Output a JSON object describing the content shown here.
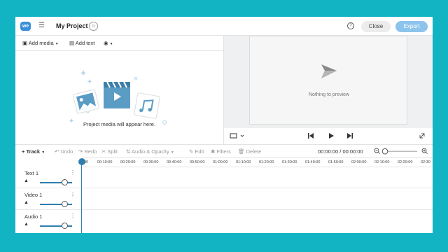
{
  "topbar": {
    "logo": "we",
    "project_title": "My Project",
    "close_label": "Close",
    "export_label": "Export"
  },
  "media_toolbar": {
    "add_media_label": "Add media",
    "add_text_label": "Add text"
  },
  "media_panel": {
    "empty_text": "Project media will appear here."
  },
  "preview": {
    "empty_text": "Nothing to preview"
  },
  "timeline_toolbar": {
    "track_label": "Track",
    "undo_label": "Undo",
    "redo_label": "Redo",
    "split_label": "Split",
    "audio_opacity_label": "Audio & Opacity",
    "edit_label": "Edit",
    "filters_label": "Filters",
    "delete_label": "Delete",
    "timecode": "00:00:00 / 00:00:00"
  },
  "ruler": {
    "ticks": [
      "00",
      "00:10:00",
      "00:20:00",
      "00:30:00",
      "00:40:00",
      "00:50:00",
      "01:00:00",
      "01:10:00",
      "01:20:00",
      "01:30:00",
      "01:40:00",
      "01:50:00",
      "02:00:00",
      "02:10:00",
      "02:20:00",
      "02:30"
    ]
  },
  "tracks": [
    {
      "name": "Text 1"
    },
    {
      "name": "Video 1"
    },
    {
      "name": "Audio 1"
    }
  ],
  "colors": {
    "background": "#12b4c4",
    "accent": "#2e7fb0",
    "export_button": "#8cc4ec",
    "logo": "#3a8fd9"
  }
}
